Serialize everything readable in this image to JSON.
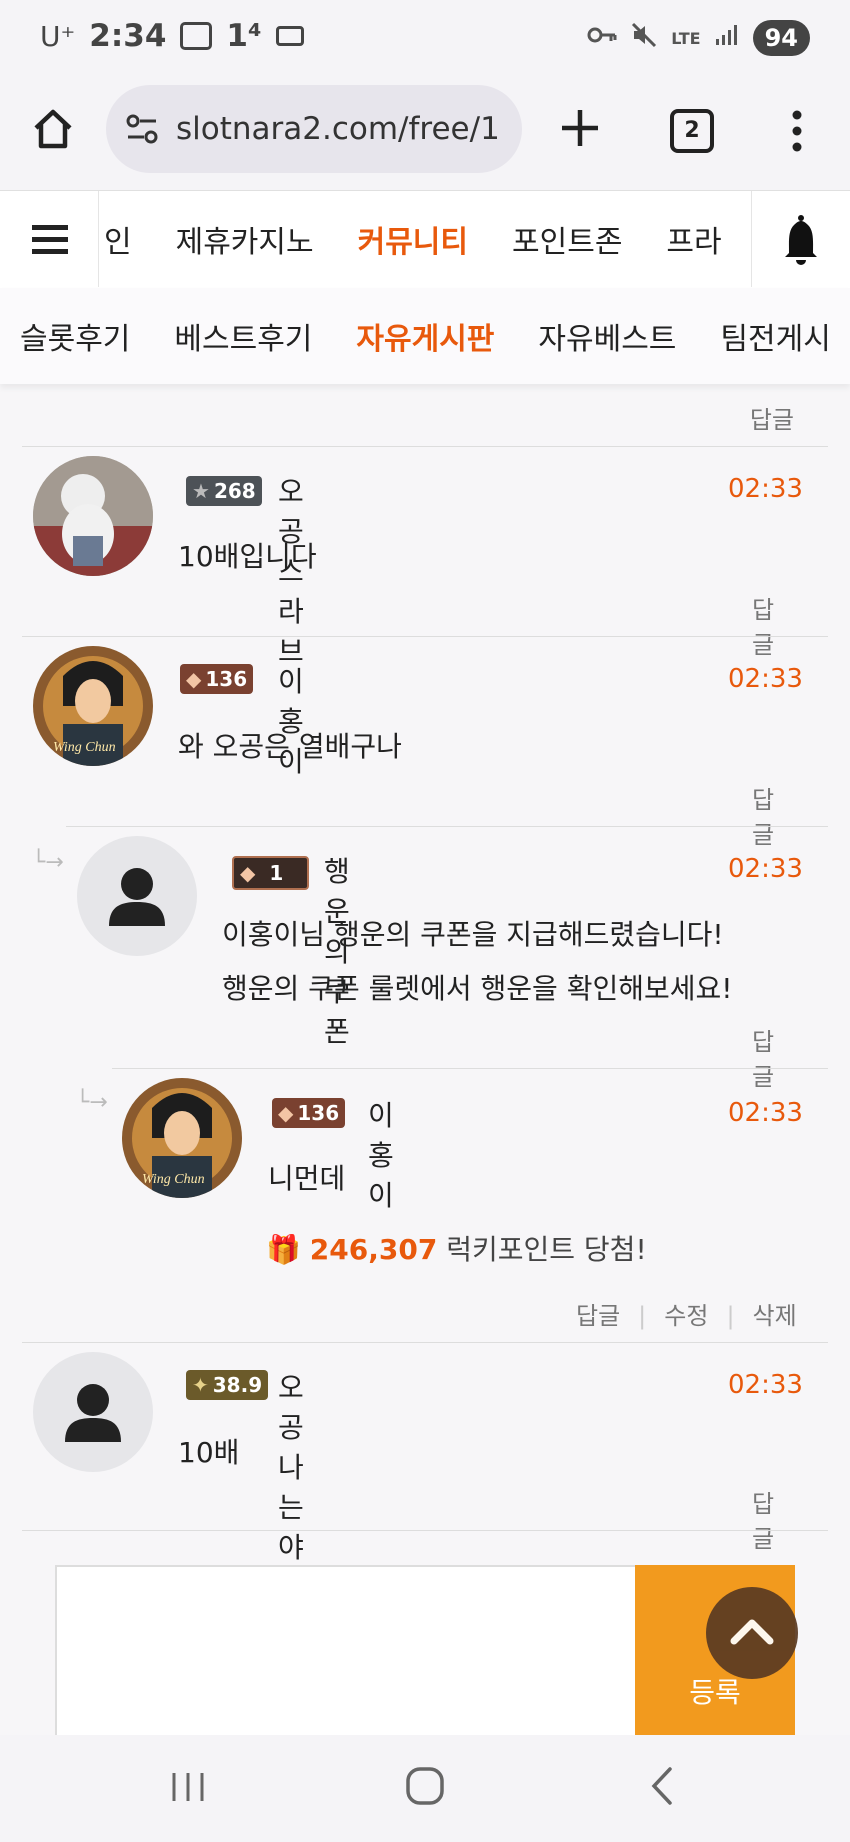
{
  "status": {
    "carrier": "U⁺",
    "time": "2:34",
    "extra": "1⁴",
    "network": "LTE",
    "battery": "94"
  },
  "browser": {
    "url": "slotnara2.com/free/1",
    "tab_count": "2"
  },
  "nav": {
    "items": [
      {
        "label": "인",
        "active": false
      },
      {
        "label": "제휴카지노",
        "active": false
      },
      {
        "label": "커뮤니티",
        "active": true
      },
      {
        "label": "포인트존",
        "active": false
      },
      {
        "label": "프라",
        "active": false
      }
    ]
  },
  "subnav": {
    "items": [
      {
        "label": "슬롯후기"
      },
      {
        "label": "베스트후기"
      },
      {
        "label": "자유게시판",
        "active": true
      },
      {
        "label": "자유베스트"
      },
      {
        "label": "팀전게시"
      }
    ]
  },
  "top_reply": "답글",
  "comments": [
    {
      "level": "268",
      "username": "오공스라브",
      "time": "02:33",
      "text": "10배입니다",
      "reply": "답글"
    },
    {
      "level": "136",
      "username": "이홍이",
      "time": "02:33",
      "text": "와 오공은 열배구나",
      "reply": "답글"
    },
    {
      "level": "1",
      "username": "행운의쿠폰",
      "time": "02:33",
      "text1": "이홍이님 행운의 쿠폰을 지급해드렸습니다!",
      "text2": "행운의 쿠폰 룰렛에서 행운을 확인해보세요!",
      "reply": "답글"
    },
    {
      "level": "136",
      "username": "이홍이",
      "time": "02:33",
      "text": "니먼데",
      "lucky_points": "246,307",
      "lucky_text": "럭키포인트 당첨!",
      "reply": "답글",
      "edit": "수정",
      "delete": "삭제"
    },
    {
      "level": "38.9",
      "username": "오공나는야빙신",
      "time": "02:33",
      "text": "10배",
      "reply": "답글"
    }
  ],
  "submit_label": "등록"
}
